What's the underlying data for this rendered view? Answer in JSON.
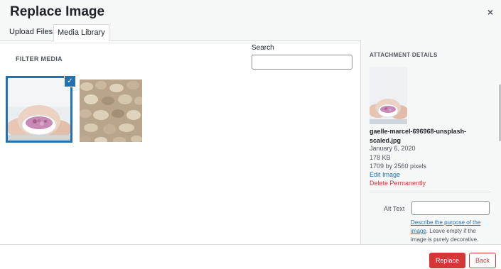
{
  "modal": {
    "title": "Replace Image",
    "close_glyph": "×"
  },
  "tabs": [
    {
      "label": "Upload Files",
      "active": false
    },
    {
      "label": "Media Library",
      "active": true
    }
  ],
  "library": {
    "filter_label": "FILTER MEDIA",
    "search_label": "Search",
    "search_value": "",
    "items": [
      {
        "description": "bowl of flowers held in hands",
        "selected": true
      },
      {
        "description": "pile of oat flakes",
        "selected": false
      }
    ],
    "check_glyph": "✓"
  },
  "details": {
    "title": "ATTACHMENT DETAILS",
    "filename": "gaelle-marcel-696968-unsplash-scaled.jpg",
    "date": "January 6, 2020",
    "size": "178 KB",
    "dimensions": "1709 by 2560 pixels",
    "edit_link": "Edit Image",
    "delete_link": "Delete Permanently",
    "alt_label": "Alt Text",
    "alt_value": "",
    "alt_help_link": "Describe the purpose of the image",
    "alt_help_rest": ". Leave empty if the image is purely decorative."
  },
  "footer": {
    "replace_label": "Replace",
    "back_label": "Back"
  },
  "colors": {
    "accent": "#2271b1",
    "danger": "#d63638"
  }
}
